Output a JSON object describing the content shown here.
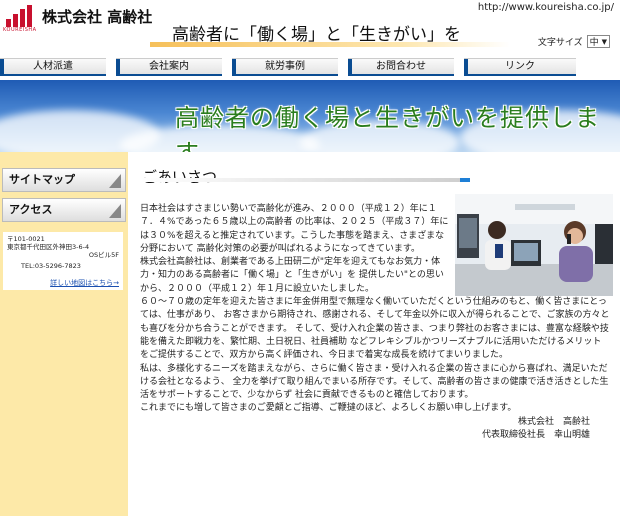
{
  "header": {
    "logo_caption": "KOUREISHA",
    "company": "株式会社 高齢社",
    "url": "http://www.koureisha.co.jp/",
    "tagline": "高齢者に「働く場」と「生きがい」を",
    "font_size_label": "文字サイズ",
    "font_size_value": "中"
  },
  "nav": {
    "items": [
      "人材派遣",
      "会社案内",
      "就労事例",
      "お問合わせ",
      "リンク"
    ]
  },
  "banner": {
    "text": "高齢者の働く場と生きがいを提供します。"
  },
  "sidebar": {
    "sitemap": "サイトマップ",
    "access": "アクセス",
    "address_1": "〒101-0021",
    "address_2": "東京都千代田区外神田3-6-4",
    "address_3": "OSビル5F",
    "tel": "TEL:03-5296-7823",
    "map_link": "詳しい地図はこちら→"
  },
  "main": {
    "heading": "ごあいさつ",
    "paragraphs": [
      "日本社会はすさまじい勢いで高齢化が進み、２０００（平成１２）年に１７．４%であった６５歳以上の高齢者 の比率は、２０２５（平成３７）年には３０%を超えると推定されています。こうした事態を踏まえ、さまざまな分野において 高齢化対策の必要が叫ばれるようになってきています。",
      "株式会社高齢社は、創業者である上田研二が\"定年を迎えてもなお気力・体力・知力のある高齢者に「働く場」と「生きがい」を 提供したい\"との思いから、２０００（平成１２）年１月に設立いたしました。",
      "６０～７０歳の定年を迎えた皆さまに年金併用型で無理なく働いていただくという仕組みのもと、働く皆さまにとっては、仕事があり、 お客さまから期待され、感謝される、そして年金以外に収入が得られることで、ご家族の方々とも喜びを分かち合うことができます。 そして、受け入れ企業の皆さま、つまり弊社のお客さまには、豊富な経験や技能を備えた即戦力を、繁忙期、土日祝日、社員補助 などフレキシブルかつリーズナブルに活用いただけるメリットをご提供することで、双方から高く評価され、今日まで着実な成長を続けてまいりました。",
      "私は、多様化するニーズを踏まえながら、さらに働く皆さま・受け入れる企業の皆さまに心から喜ばれ、満足いただける会社となるよう、 全力を挙げて取り組んでまいる所存です。そして、高齢者の皆さまの健康で活き活きとした生活をサポートすることで、少なからず 社会に貢献できるものと確信しております。",
      "これまでにも増して皆さまのご愛顧とご指導、ご鞭撻のほど、よろしくお願い申し上げます。"
    ],
    "sign_company": "株式会社　高齢社",
    "sign_person": "代表取締役社長　幸山明雄"
  },
  "colors": {
    "brand_red": "#c8102e",
    "nav_blue": "#0a4c92",
    "sidebar_bg": "#fde9a8",
    "banner_text_green": "#2a7d1e"
  }
}
